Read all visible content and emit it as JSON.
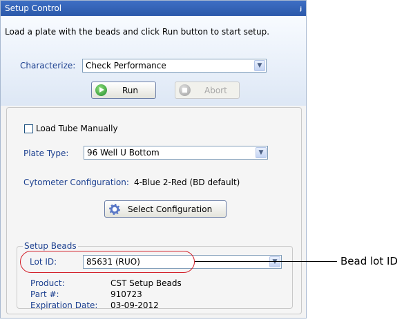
{
  "panel": {
    "title": "Setup Control",
    "pin_glyph": "ⱼ",
    "instruction": "Load a plate with the beads and click Run button to start setup.",
    "characterize_label": "Characterize:",
    "characterize_value": "Check Performance",
    "run_label": "Run",
    "abort_label": "Abort",
    "load_tube_label": "Load Tube Manually",
    "load_tube_checked": false,
    "plate_type_label": "Plate Type:",
    "plate_type_value": "96 Well U Bottom",
    "cytometer_label": "Cytometer Configuration:",
    "cytometer_value": "4-Blue 2-Red (BD default)",
    "select_config_label": "Select Configuration",
    "setup_beads": {
      "title": "Setup Beads",
      "lot_id_label": "Lot ID:",
      "lot_id_value": "85631 (RUO)",
      "product_label": "Product:",
      "product_value": "CST Setup Beads",
      "part_label": "Part #:",
      "part_value": "910723",
      "expiration_label": "Expiration Date:",
      "expiration_value": "03-09-2012"
    }
  },
  "annotation": {
    "callout_text": "Bead lot ID",
    "highlight_color": "#d3202a"
  },
  "icons": {
    "dropdown_arrow": "⌵",
    "run": "green-play-icon",
    "abort": "gray-stop-icon",
    "configure": "gear-icon"
  }
}
